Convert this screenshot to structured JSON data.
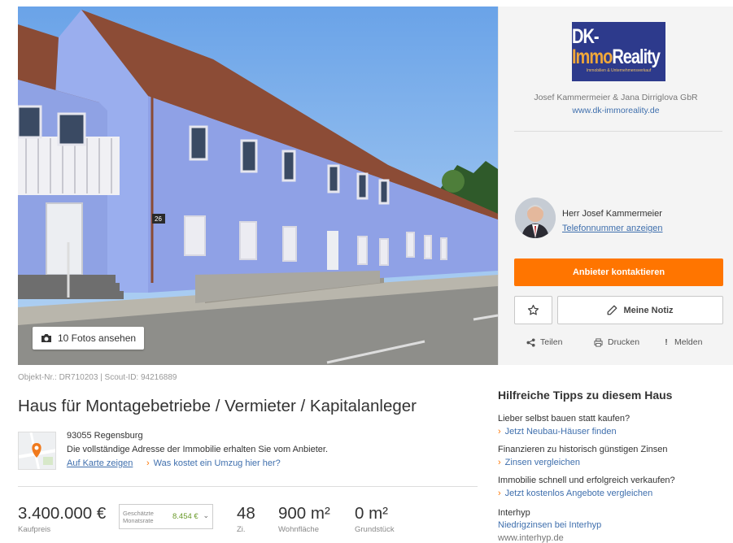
{
  "gallery": {
    "photos_button_label": "10 Fotos ansehen",
    "house_number": "26"
  },
  "provider": {
    "logo_text_dk": "DK-",
    "logo_text_immo": "Immo",
    "logo_text_reality": "Reality",
    "logo_subtext": "Immobilien & Unternehmensverkauf",
    "company": "Josef Kammermeier & Jana Dirriglova GbR",
    "website": "www.dk-immoreality.de",
    "agent_name": "Herr Josef Kammermeier",
    "phone_link": "Telefonnummer anzeigen",
    "contact_button": "Anbieter kontaktieren",
    "note_button": "Meine Notiz",
    "share_label": "Teilen",
    "print_label": "Drucken",
    "report_label": "Melden",
    "colors": {
      "accent": "#ff7500",
      "link": "#3f6fad",
      "logo_bg": "#2d3a8c"
    }
  },
  "listing": {
    "object_ids": "Objekt-Nr.: DR710203 | Scout-ID: 94216889",
    "title": "Haus für Montagebetriebe / Vermieter / Kapitalanleger",
    "city": "93055 Regensburg",
    "address_note": "Die vollständige Adresse der Immobilie erhalten Sie vom Anbieter.",
    "map_link": "Auf Karte zeigen",
    "move_link": "Was kostet ein Umzug hier her?",
    "price": "3.400.000 €",
    "price_label": "Kaufpreis",
    "rate_label_1": "Geschätzte",
    "rate_label_2": "Monatsrate",
    "rate_value": "8.454 €",
    "rooms": "48",
    "rooms_label": "Zi.",
    "living_area": "900 m²",
    "living_area_label": "Wohnfläche",
    "plot_area": "0 m²",
    "plot_area_label": "Grundstück"
  },
  "tips": {
    "title": "Hilfreiche Tipps zu diesem Haus",
    "items": [
      {
        "question": "Lieber selbst bauen statt kaufen?",
        "link": "Jetzt Neubau-Häuser finden"
      },
      {
        "question": "Finanzieren zu historisch günstigen Zinsen",
        "link": "Zinsen vergleichen"
      },
      {
        "question": "Immobilie schnell und erfolgreich verkaufen?",
        "link": "Jetzt kostenlos Angebote vergleichen"
      }
    ],
    "sponsor_name": "Interhyp",
    "sponsor_link": "Niedrigzinsen bei Interhyp",
    "sponsor_url": "www.interhyp.de"
  }
}
